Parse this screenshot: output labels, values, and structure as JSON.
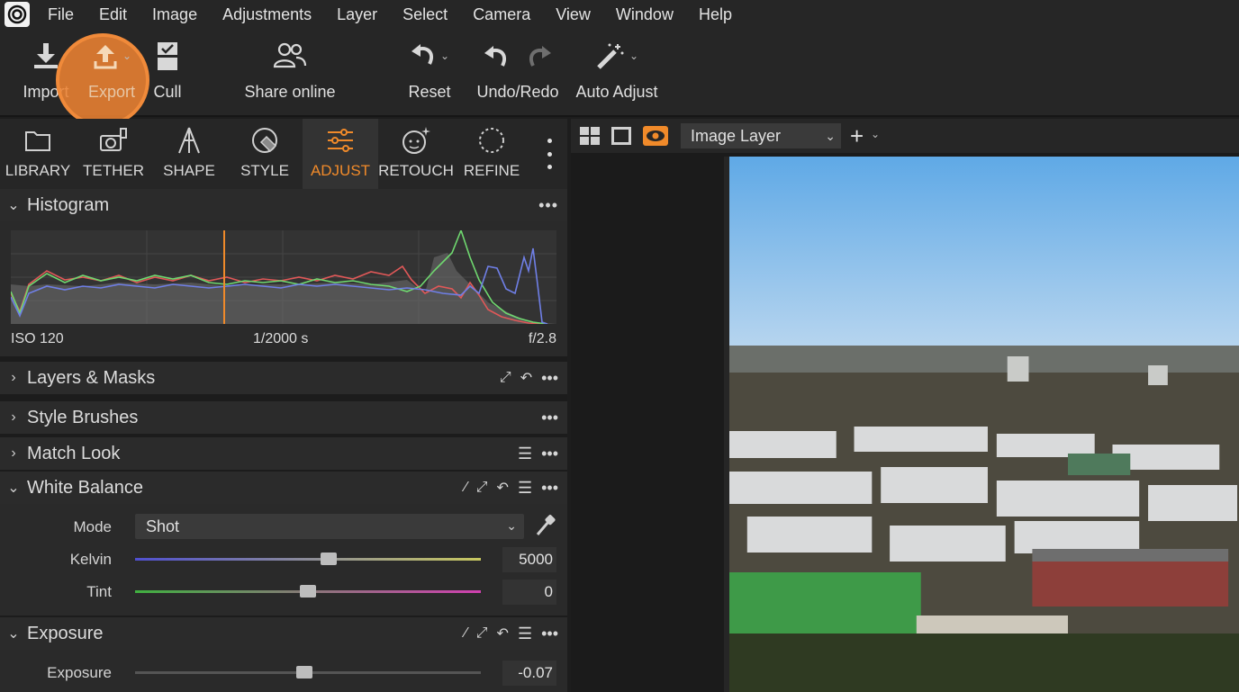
{
  "menubar": {
    "items": [
      "File",
      "Edit",
      "Image",
      "Adjustments",
      "Layer",
      "Select",
      "Camera",
      "View",
      "Window",
      "Help"
    ]
  },
  "toolbar": {
    "import_label": "Import",
    "export_label": "Export",
    "cull_label": "Cull",
    "share_label": "Share online",
    "reset_label": "Reset",
    "undo_redo_label": "Undo/Redo",
    "auto_adjust_label": "Auto Adjust"
  },
  "tabs": [
    {
      "label": "LIBRARY",
      "icon": "folder-icon"
    },
    {
      "label": "TETHER",
      "icon": "camera-tether-icon"
    },
    {
      "label": "SHAPE",
      "icon": "shape-icon"
    },
    {
      "label": "STYLE",
      "icon": "style-icon"
    },
    {
      "label": "ADJUST",
      "icon": "sliders-icon",
      "active": true
    },
    {
      "label": "RETOUCH",
      "icon": "retouch-face-icon"
    },
    {
      "label": "REFINE",
      "icon": "refine-circle-icon"
    }
  ],
  "histogram": {
    "title": "Histogram",
    "iso": "ISO 120",
    "shutter": "1/2000 s",
    "aperture": "f/2.8"
  },
  "sections": {
    "layers_masks": "Layers & Masks",
    "style_brushes": "Style Brushes",
    "match_look": "Match Look",
    "white_balance": "White Balance",
    "exposure": "Exposure"
  },
  "white_balance": {
    "mode_label": "Mode",
    "mode_value": "Shot",
    "kelvin_label": "Kelvin",
    "kelvin_value": "5000",
    "kelvin_position": 0.56,
    "tint_label": "Tint",
    "tint_value": "0",
    "tint_position": 0.5
  },
  "exposure": {
    "exposure_label": "Exposure",
    "exposure_value": "-0.07",
    "exposure_position": 0.49
  },
  "viewer": {
    "layer_select": "Image Layer"
  },
  "colors": {
    "accent": "#f08a2a",
    "panel": "#2a2a2a",
    "toolbar": "#262626"
  }
}
